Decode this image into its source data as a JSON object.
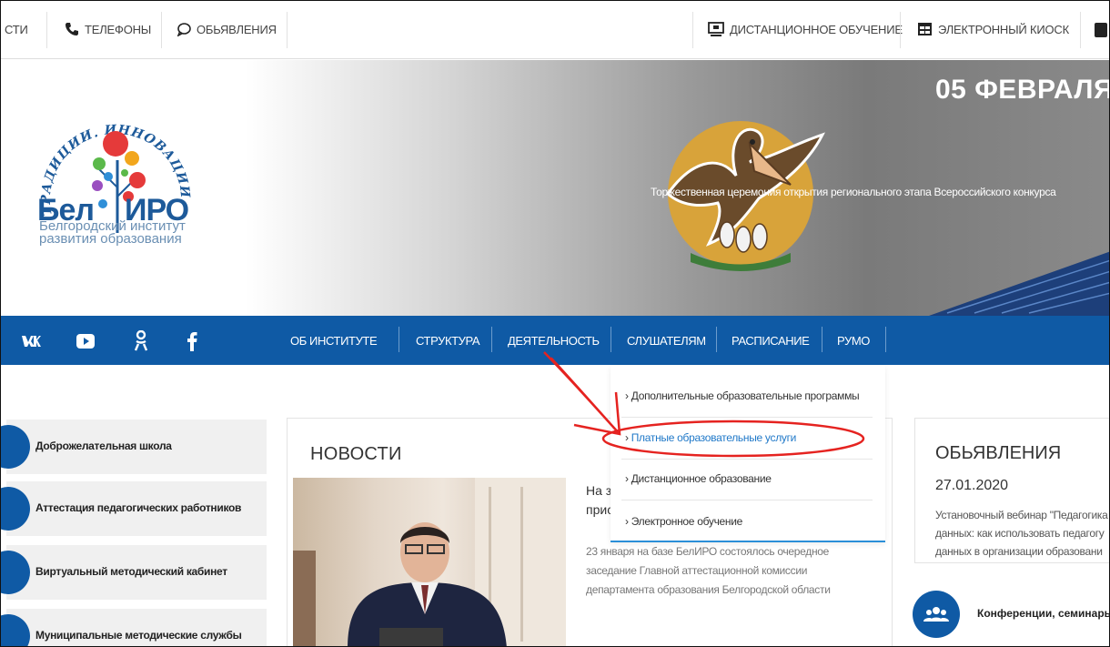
{
  "topbar": {
    "items": [
      {
        "label": "СТИ",
        "icon": "none"
      },
      {
        "label": "ТЕЛЕФОНЫ",
        "icon": "phone-icon"
      },
      {
        "label": "ОБЬЯВЛЕНИЯ",
        "icon": "speech-bubble-icon"
      },
      {
        "label": "ДИСТАНЦИОННОЕ ОБУЧЕНИЕ",
        "icon": "monitor-icon"
      },
      {
        "label": "ЭЛЕКТРОННЫЙ КИОСК",
        "icon": "grid-icon"
      }
    ]
  },
  "logo": {
    "arc_text": "ТРАДИЦИИ. ИННОВАЦИИ. УСПЕХ",
    "bel": "Бел",
    "iro": "ИРО",
    "line1": "Белгородский институт",
    "line2": "развития образования"
  },
  "banner": {
    "date": "05 ФЕВРАЛЯ",
    "caption": "Торжественная церемония открытия регионального этапа Всероссийского конкурса"
  },
  "social": [
    "vk-icon",
    "youtube-icon",
    "odnoklassniki-icon",
    "facebook-icon"
  ],
  "nav": {
    "items": [
      "ОБ ИНСТИТУТЕ",
      "СТРУКТУРА",
      "ДЕЯТЕЛЬНОСТЬ",
      "СЛУШАТЕЛЯМ",
      "РАСПИСАНИЕ",
      "РУМО"
    ]
  },
  "dropdown": {
    "items": [
      "Дополнительные образовательные программы",
      "Платные образовательные услуги",
      "Дистанционное образование",
      "Электронное обучение"
    ],
    "highlight_color": "#e52320"
  },
  "left_menu": {
    "items": [
      "Доброжелательная школа",
      "Аттестация педагогических работников",
      "Виртуальный методический кабинет",
      "Муниципальные методические службы"
    ]
  },
  "news": {
    "title": "НОВОСТИ",
    "headline1": "На з",
    "headline2": "прис",
    "excerpt": [
      "23 января на базе БелИРО состоялось очередное",
      "заседание Главной аттестационной комиссии",
      "департамента образования Белгородской области"
    ]
  },
  "announcements": {
    "title": "ОБЬЯВЛЕНИЯ",
    "date": "27.01.2020",
    "lines": [
      "Установочный вебинар \"Педагогика",
      "данных: как использовать педагогу",
      "данных в организации образовани"
    ],
    "conference_label": "Конференции, семинары"
  },
  "colors": {
    "brand_blue": "#0f5aa5",
    "dropdown_accent": "#2b8fd8",
    "annotation_red": "#e52320"
  }
}
